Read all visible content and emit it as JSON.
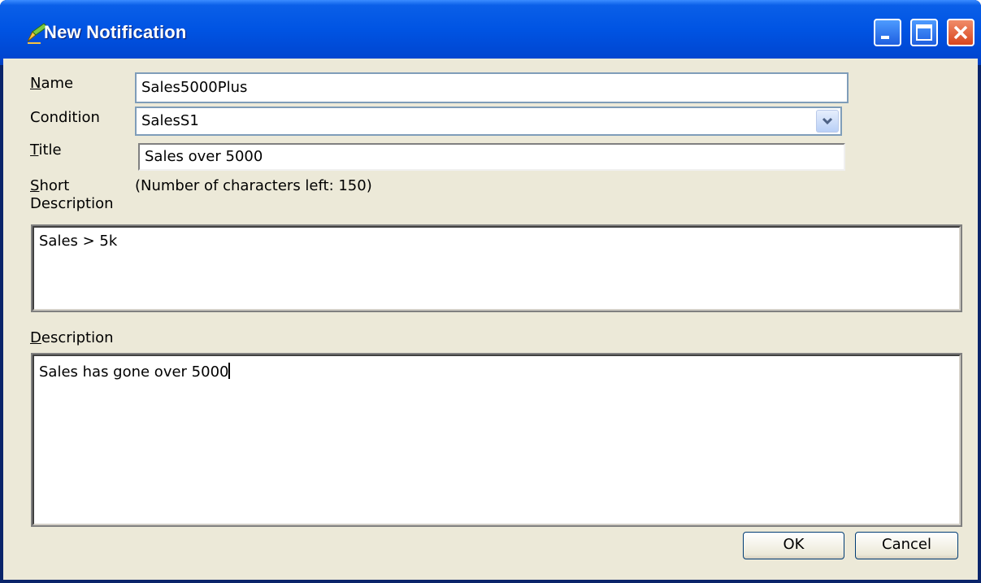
{
  "window": {
    "title": "New Notification"
  },
  "fields": {
    "name": {
      "label_u": "N",
      "label_rest": "ame",
      "value": "Sales5000Plus"
    },
    "condition": {
      "label": "Condition",
      "value": "SalesS1"
    },
    "title": {
      "label_u": "T",
      "label_rest": "itle",
      "value": "Sales over 5000"
    },
    "short_description": {
      "label_line1_u": "S",
      "label_line1_rest": "hort",
      "label_line2": "Description",
      "chars_left": "(Number of characters left: 150)",
      "value": "Sales > 5k"
    },
    "description": {
      "label_u": "D",
      "label_rest": "escription",
      "value": "Sales has gone over 5000"
    }
  },
  "buttons": {
    "ok": "OK",
    "cancel": "Cancel"
  },
  "colors": {
    "titlebar": "#0054e3",
    "dialog_bg": "#ece9d8",
    "close_button": "#d8461e"
  }
}
